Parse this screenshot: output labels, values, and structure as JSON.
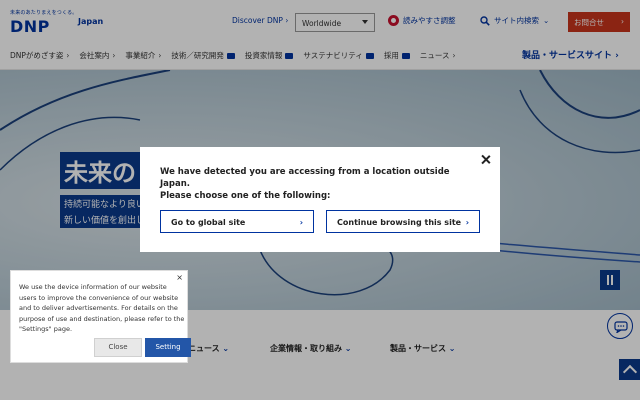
{
  "header": {
    "logo_tagline": "未来のあたりまえをつくる。",
    "logo_text": "DNP",
    "region": "Japan",
    "discover": "Discover DNP",
    "worldwide_select": "Worldwide",
    "accessibility": "読みやすさ調整",
    "site_search": "サイト内検索",
    "contact": "お問合せ",
    "contact_color": "#c8341c",
    "products_site": "製品・サービスサイト",
    "nav": [
      {
        "label": "DNPがめざす姿",
        "external": false
      },
      {
        "label": "会社案内",
        "external": false
      },
      {
        "label": "事業紹介",
        "external": false
      },
      {
        "label": "技術／研究開発",
        "external": true
      },
      {
        "label": "投資家情報",
        "external": true
      },
      {
        "label": "サステナビリティ",
        "external": true
      },
      {
        "label": "採用",
        "external": true
      },
      {
        "label": "ニュース",
        "external": false
      }
    ]
  },
  "hero": {
    "title": "未来の",
    "sub1": "持続可能なより良い",
    "sub2": "新しい価値を創出し"
  },
  "lower_tabs": [
    {
      "label": "ニュース"
    },
    {
      "label": "企業情報・取り組み"
    },
    {
      "label": "製品・サービス"
    }
  ],
  "modal": {
    "line1": "We have detected you are accessing from a location outside Japan.",
    "line2": "Please choose one of the following:",
    "global_button": "Go to global site",
    "continue_button": "Continue browsing this site",
    "chevron": "›"
  },
  "cookie": {
    "close_x": "×",
    "text": "We use the device information of our website users to improve the convenience of our website and to deliver advertisements. For details on the purpose of use and destination, please refer to the \"Settings\" page.",
    "close_button": "Close",
    "setting_button": "Setting"
  },
  "brand_color": "#0033a0"
}
